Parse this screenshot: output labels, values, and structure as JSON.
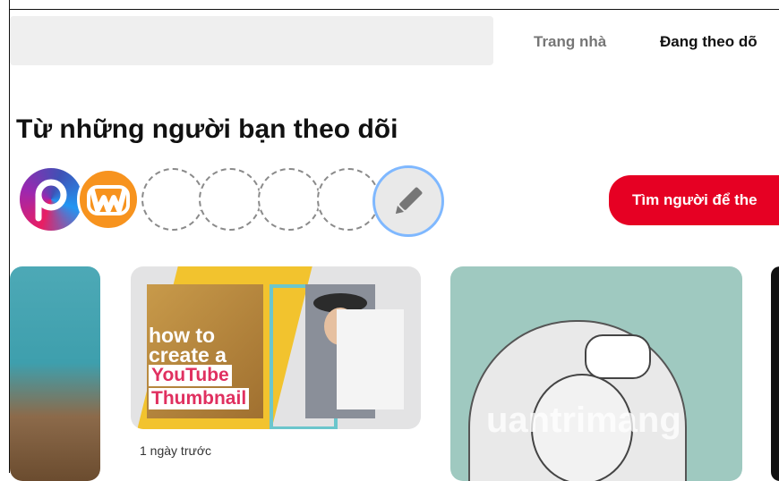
{
  "header": {
    "nav": {
      "home_label": "Trang nhà",
      "following_label": "Đang theo dõ"
    }
  },
  "section": {
    "title": "Từ những người bạn theo dõi",
    "find_people_button": "Tìm người để the"
  },
  "avatars": [
    {
      "name": "picsart-avatar",
      "icon": "picsart-logo"
    },
    {
      "name": "wattpad-avatar",
      "icon": "wattpad-logo"
    },
    {
      "name": "empty-slot"
    },
    {
      "name": "empty-slot"
    },
    {
      "name": "empty-slot"
    },
    {
      "name": "empty-slot"
    },
    {
      "name": "edit-following-button",
      "icon": "pencil-icon"
    }
  ],
  "pins": {
    "pin2": {
      "thumbnail_lines": [
        "how to",
        "create a",
        "YouTube",
        "Thumbnail"
      ],
      "meta": "1 ngày trước"
    },
    "pin3": {
      "watermark": "uantrimang"
    }
  },
  "colors": {
    "accent": "#e60023",
    "search_bg": "#efefef",
    "edit_ring": "#7fb8ff"
  }
}
